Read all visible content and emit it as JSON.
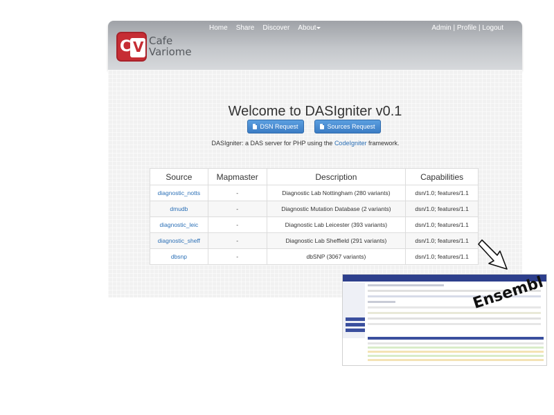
{
  "header": {
    "logo_line1": "Cafe",
    "logo_line2": "Variome",
    "logo_letters": "CV",
    "nav": [
      "Home",
      "Share",
      "Discover",
      "About"
    ],
    "user_links": [
      "Admin",
      "Profile",
      "Logout"
    ],
    "separator": " | "
  },
  "main": {
    "title": "Welcome to DASIgniter v0.1",
    "intro_before": "DASIgniter: a DAS server for PHP using the ",
    "intro_link": "CodeIgniter",
    "intro_after": " framework.",
    "buttons": [
      "DSN Request",
      "Sources Request"
    ],
    "table": {
      "headers": [
        "Source",
        "Mapmaster",
        "Description",
        "Capabilities"
      ],
      "rows": [
        [
          "diagnostic_notts",
          "-",
          "Diagnostic Lab Nottingham (280 variants)",
          "dsn/1.0; features/1.1"
        ],
        [
          "dmudb",
          "-",
          "Diagnostic Mutation Database (2 variants)",
          "dsn/1.0; features/1.1"
        ],
        [
          "diagnostic_leic",
          "-",
          "Diagnostic Lab Leicester (393 variants)",
          "dsn/1.0; features/1.1"
        ],
        [
          "diagnostic_sheff",
          "-",
          "Diagnostic Lab Sheffield (291 variants)",
          "dsn/1.0; features/1.1"
        ],
        [
          "dbsnp",
          "-",
          "dbSNP (3067 variants)",
          "dsn/1.0; features/1.1"
        ]
      ]
    }
  },
  "annotation": {
    "label": "Ensembl"
  },
  "colors": {
    "logo_red": "#c62d34",
    "link_blue": "#2a6fb6",
    "button_blue": "#428bca",
    "ensembl_navy": "#2d3f8c"
  },
  "icons": [
    "file-icon",
    "caret-down-icon",
    "arrow-down-right-icon"
  ]
}
